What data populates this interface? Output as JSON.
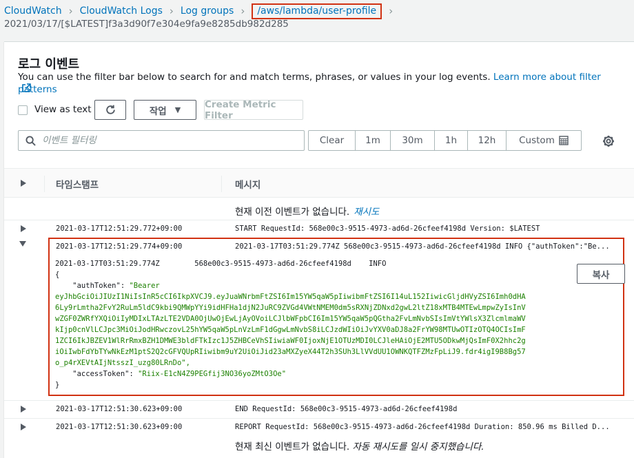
{
  "breadcrumb": {
    "items": [
      "CloudWatch",
      "CloudWatch Logs",
      "Log groups"
    ],
    "current": "/aws/lambda/user-profile"
  },
  "log_stream": "2021/03/17/[$LATEST]f3a3d90f7e304e9fa9e8285db982d285",
  "panel": {
    "heading": "로그 이벤트",
    "description": "You can use the filter bar below to search for and match terms, phrases, or values in your log events.",
    "learn_more_link": "Learn more about filter patterns"
  },
  "toolbar": {
    "view_as_text_label": "View as text",
    "view_as_text_checked": false,
    "actions_label": "작업",
    "create_metric_filter_label": "Create Metric Filter"
  },
  "filter": {
    "placeholder": "이벤트 필터링",
    "ranges": [
      "Clear",
      "1m",
      "30m",
      "1h",
      "12h",
      "Custom"
    ]
  },
  "table": {
    "headers": {
      "timestamp": "타임스탬프",
      "message": "메시지"
    },
    "no_older_events": "현재 이전 이벤트가 없습니다.",
    "retry_label": "재시도",
    "no_newer_events_prefix": "현재 최신 이벤트가 없습니다.",
    "no_newer_events_suffix": "자동 재시도를 일시 중지했습니다.",
    "rows": [
      {
        "timestamp": "2021-03-17T12:51:29.772+09:00",
        "message": "START RequestId: 568e00c3-9515-4973-ad6d-26cfeef4198d Version: $LATEST",
        "expanded": false
      },
      {
        "timestamp": "2021-03-17T12:51:29.774+09:00",
        "message": "2021-03-17T03:51:29.774Z 568e00c3-9515-4973-ad6d-26cfeef4198d INFO {\"authToken\":\"Be...",
        "expanded": true
      },
      {
        "timestamp": "2021-03-17T12:51:30.623+09:00",
        "message": "END RequestId: 568e00c3-9515-4973-ad6d-26cfeef4198d",
        "expanded": false
      },
      {
        "timestamp": "2021-03-17T12:51:30.623+09:00",
        "message": "REPORT RequestId: 568e00c3-9515-4973-ad6d-26cfeef4198d Duration: 850.96 ms Billed D...",
        "expanded": false
      }
    ],
    "expanded_detail": {
      "header": "2021-03-17T03:51:29.774Z        568e00c3-9515-4973-ad6d-26cfeef4198d    INFO",
      "open_brace": "{",
      "auth_key": "    \"authToken\": ",
      "auth_value_lines": [
        "\"Bearer",
        "eyJhbGciOiJIUzI1NiIsInR5cCI6IkpXVCJ9.eyJuaWNrbmFtZSI6Im15YW5qaW5pIiwibmFtZSI6I14uL152IiwicGljdHVyZSI6Imh0dHA",
        "6Ly9rLmtha2FvY2RuLm5ldC9kbi9QMWpYYi9idHFHa1djN2JuRC9ZVGd4VWtNMEM0dm5sRXNjZDNxd2gwL2ltZ18xMTB4MTEwLmpwZyIsInV",
        "wZGF0ZWRfYXQiOiIyMDIxLTAzLTE2VDA0OjUwOjEwLjAyOVoiLCJlbWFpbCI6Im15YW5qaW5pQGtha2FvLmNvbSIsImVtYWlsX3ZlcmlmaWV",
        "kIjp0cnVlLCJpc3MiOiJodHRwczovL25hYW5qaW5pLnVzLmF1dGgwLmNvbS8iLCJzdWIiOiJvYXV0aDJ8a2FrYW98MTUwOTIzOTQ4OCIsImF",
        "1ZCI6IkJBZEV1WlRrRmxBZH1DMWE3bldFTkIzc1J5ZHBCeVhSIiwiaWF0IjoxNjE1OTUzMDI0LCJleHAiOjE2MTU5ODkwMjQsImF0X2hhc2g",
        "iOiIwbFdYbTYwNkEzM1ptS2Q2cGFVQUpRIiwibm9uY2UiOiJid23aMXZyeX44T2h3SUh3LlVVdUU1OWNKQTFZMzFpLiJ9.fdr4igI9B8Bg57",
        "o_p4rXEVtAIjNtsszI_uzg80LRnDo\","
      ],
      "access_key": "    \"accessToken\": ",
      "access_value": "\"Riix-E1cN4Z9PEGfij3NO36yoZMtO3Oe\"",
      "close_brace": "}",
      "copy_label": "복사"
    }
  },
  "colors": {
    "link": "#0073bb",
    "highlight_border": "#d13212",
    "json_string": "#1d8102"
  }
}
